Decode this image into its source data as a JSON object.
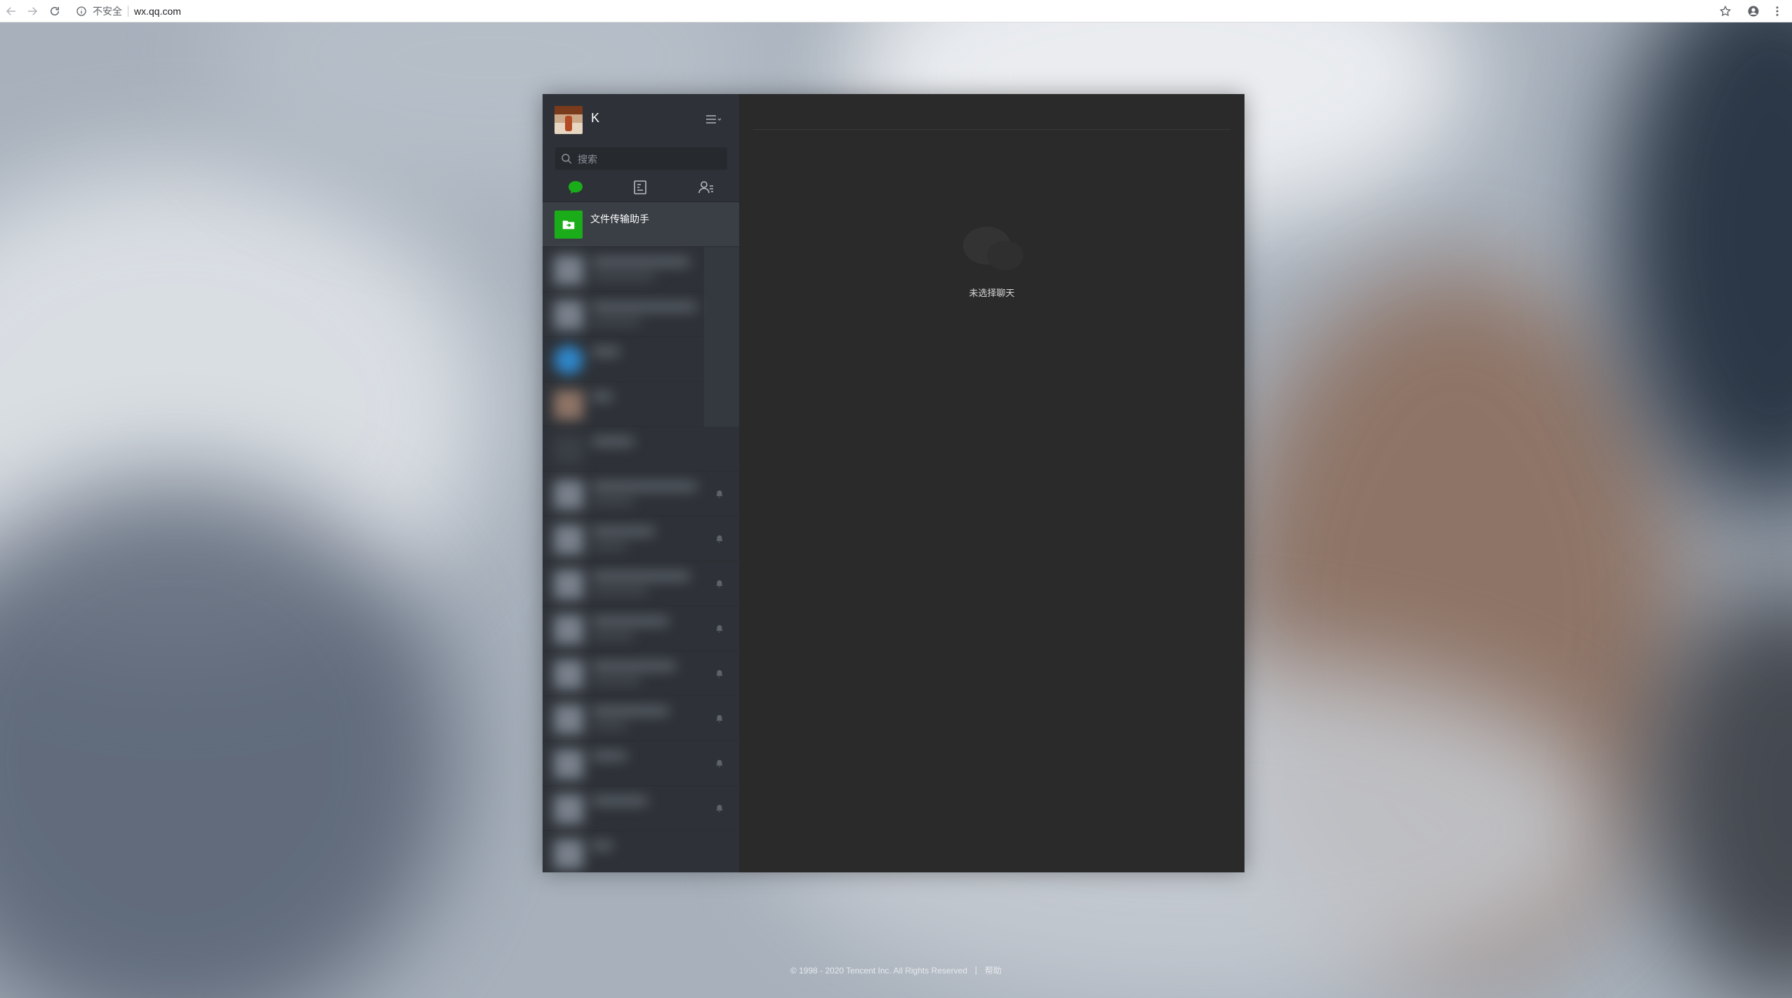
{
  "browser": {
    "security_label": "不安全",
    "url": "wx.qq.com"
  },
  "profile": {
    "nickname": "K"
  },
  "search": {
    "placeholder": "搜索"
  },
  "chat_list": {
    "pinned": {
      "name": "文件传输助手",
      "icon": "folder-icon"
    }
  },
  "main": {
    "empty_text": "未选择聊天"
  },
  "footer": {
    "copyright": "© 1998 - 2020 Tencent Inc. All Rights Reserved",
    "help": "帮助"
  },
  "colors": {
    "accent_green": "#1aad19",
    "panel_bg": "#2e3238",
    "content_bg": "#2a2a2a"
  }
}
